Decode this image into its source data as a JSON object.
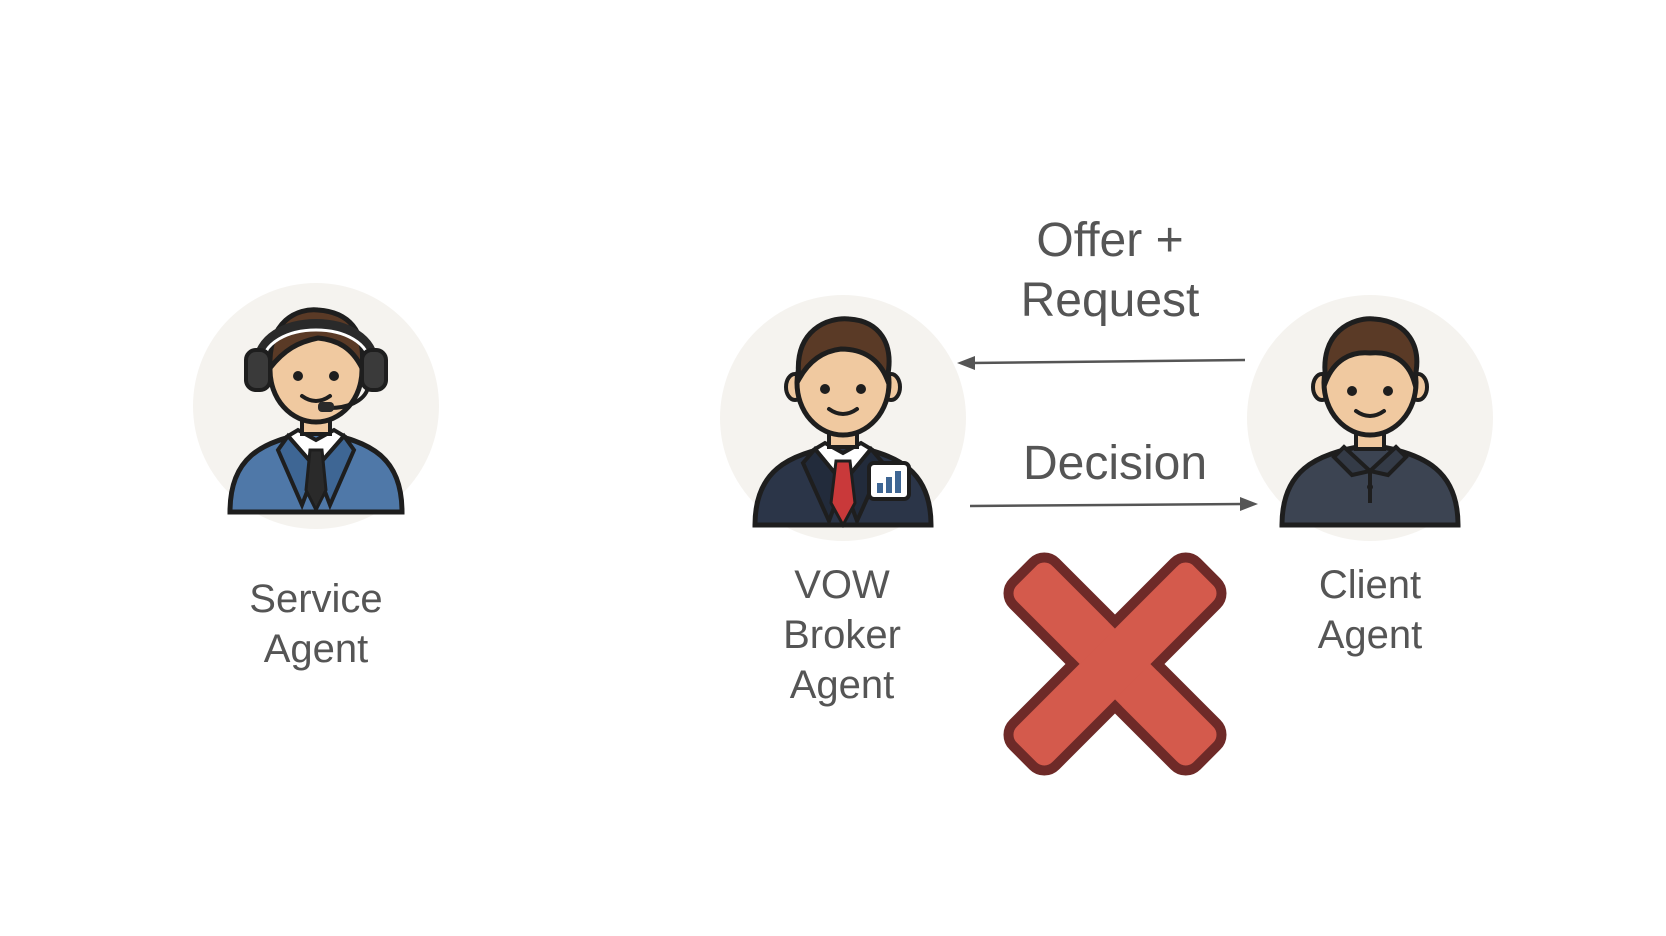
{
  "agents": {
    "service": {
      "line1": "Service",
      "line2": "Agent",
      "icon": "headset-agent-icon"
    },
    "broker": {
      "line1": "VOW",
      "line2": "Broker",
      "line3": "Agent",
      "icon": "broker-agent-icon"
    },
    "client": {
      "line1": "Client",
      "line2": "Agent",
      "icon": "client-agent-icon"
    }
  },
  "edges": {
    "offer": {
      "line1": "Offer +",
      "line2": "Request",
      "direction": "client-to-broker"
    },
    "decision": {
      "label": "Decision",
      "direction": "broker-to-client",
      "status": "rejected"
    }
  },
  "colors": {
    "label_text": "#555555",
    "avatar_bg": "#f5f3ef",
    "reject_fill": "#d45a4c",
    "reject_outline": "#6e2a28",
    "broker_suit": "#2b3548",
    "service_suit": "#4f78a8",
    "client_shirt": "#3c4452",
    "tie_red": "#c9393a"
  },
  "icons": {
    "reject": "red-x-icon"
  }
}
